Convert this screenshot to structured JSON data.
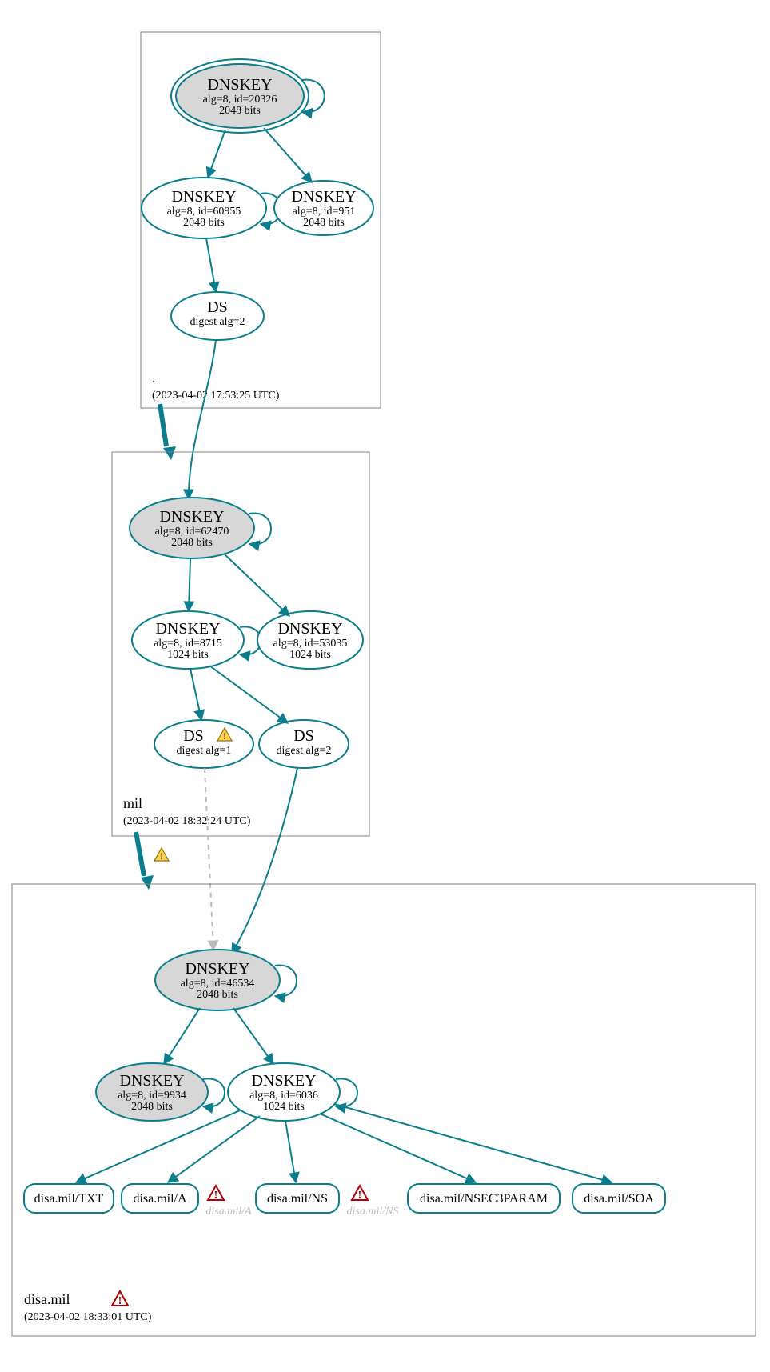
{
  "chart_data": {
    "type": "diagram",
    "title": "DNSSEC authentication graph",
    "zones": [
      {
        "name": ".",
        "timestamp": "(2023-04-02 17:53:25 UTC)",
        "nodes": [
          {
            "id": "root-ksk",
            "type": "DNSKEY",
            "alg": "alg=8, id=20326",
            "bits": "2048 bits",
            "shaded": true,
            "double": true,
            "selfloop": true
          },
          {
            "id": "root-zsk1",
            "type": "DNSKEY",
            "alg": "alg=8, id=60955",
            "bits": "2048 bits",
            "selfloop": true
          },
          {
            "id": "root-zsk2",
            "type": "DNSKEY",
            "alg": "alg=8, id=951",
            "bits": "2048 bits"
          },
          {
            "id": "root-ds",
            "type": "DS",
            "alg": "digest alg=2"
          }
        ],
        "edges": [
          [
            "root-ksk",
            "root-zsk1"
          ],
          [
            "root-ksk",
            "root-zsk2"
          ],
          [
            "root-zsk1",
            "root-ds"
          ]
        ]
      },
      {
        "name": "mil",
        "timestamp": "(2023-04-02 18:32:24 UTC)",
        "nodes": [
          {
            "id": "mil-ksk",
            "type": "DNSKEY",
            "alg": "alg=8, id=62470",
            "bits": "2048 bits",
            "shaded": true,
            "selfloop": true
          },
          {
            "id": "mil-zsk1",
            "type": "DNSKEY",
            "alg": "alg=8, id=8715",
            "bits": "1024 bits",
            "selfloop": true
          },
          {
            "id": "mil-zsk2",
            "type": "DNSKEY",
            "alg": "alg=8, id=53035",
            "bits": "1024 bits"
          },
          {
            "id": "mil-ds1",
            "type": "DS",
            "alg": "digest alg=1",
            "warning": true
          },
          {
            "id": "mil-ds2",
            "type": "DS",
            "alg": "digest alg=2"
          }
        ],
        "edges": [
          [
            "mil-ksk",
            "mil-zsk1"
          ],
          [
            "mil-ksk",
            "mil-zsk2"
          ],
          [
            "mil-zsk1",
            "mil-ds1"
          ],
          [
            "mil-zsk1",
            "mil-ds2"
          ]
        ]
      },
      {
        "name": "disa.mil",
        "timestamp": "(2023-04-02 18:33:01 UTC)",
        "warning_icon": "error",
        "nodes": [
          {
            "id": "disa-ksk",
            "type": "DNSKEY",
            "alg": "alg=8, id=46534",
            "bits": "2048 bits",
            "shaded": true,
            "selfloop": true
          },
          {
            "id": "disa-ksk2",
            "type": "DNSKEY",
            "alg": "alg=8, id=9934",
            "bits": "2048 bits",
            "shaded": true,
            "selfloop": true
          },
          {
            "id": "disa-zsk",
            "type": "DNSKEY",
            "alg": "alg=8, id=6036",
            "bits": "1024 bits",
            "selfloop": true
          },
          {
            "id": "rr-txt",
            "type": "RR",
            "label": "disa.mil/TXT"
          },
          {
            "id": "rr-a",
            "type": "RR",
            "label": "disa.mil/A"
          },
          {
            "id": "rr-a-missing",
            "type": "RR-missing",
            "label": "disa.mil/A",
            "error": true
          },
          {
            "id": "rr-ns",
            "type": "RR",
            "label": "disa.mil/NS"
          },
          {
            "id": "rr-ns-missing",
            "type": "RR-missing",
            "label": "disa.mil/NS",
            "error": true
          },
          {
            "id": "rr-nsec3",
            "type": "RR",
            "label": "disa.mil/NSEC3PARAM"
          },
          {
            "id": "rr-soa",
            "type": "RR",
            "label": "disa.mil/SOA"
          }
        ],
        "edges": [
          [
            "disa-ksk",
            "disa-ksk2"
          ],
          [
            "disa-ksk",
            "disa-zsk"
          ],
          [
            "disa-zsk",
            "rr-txt"
          ],
          [
            "disa-zsk",
            "rr-a"
          ],
          [
            "disa-zsk",
            "rr-ns"
          ],
          [
            "disa-zsk",
            "rr-nsec3"
          ],
          [
            "disa-zsk",
            "rr-soa"
          ]
        ]
      }
    ],
    "interzone_edges": [
      {
        "from": "root-ds",
        "to": "mil-ksk",
        "style": "solid",
        "delegation": true
      },
      {
        "from": "mil-ds1",
        "to": "disa-ksk",
        "style": "dashed",
        "delegation_warning": true
      },
      {
        "from": "mil-ds2",
        "to": "disa-ksk",
        "style": "solid"
      }
    ]
  },
  "labels": {
    "dnskey": "DNSKEY",
    "ds": "DS"
  },
  "node_text": {
    "root_ksk_alg": "alg=8, id=20326",
    "root_ksk_bits": "2048 bits",
    "root_zsk1_alg": "alg=8, id=60955",
    "root_zsk1_bits": "2048 bits",
    "root_zsk2_alg": "alg=8, id=951",
    "root_zsk2_bits": "2048 bits",
    "root_ds_alg": "digest alg=2",
    "mil_ksk_alg": "alg=8, id=62470",
    "mil_ksk_bits": "2048 bits",
    "mil_zsk1_alg": "alg=8, id=8715",
    "mil_zsk1_bits": "1024 bits",
    "mil_zsk2_alg": "alg=8, id=53035",
    "mil_zsk2_bits": "1024 bits",
    "mil_ds1_alg": "digest alg=1",
    "mil_ds2_alg": "digest alg=2",
    "disa_ksk_alg": "alg=8, id=46534",
    "disa_ksk_bits": "2048 bits",
    "disa_ksk2_alg": "alg=8, id=9934",
    "disa_ksk2_bits": "2048 bits",
    "disa_zsk_alg": "alg=8, id=6036",
    "disa_zsk_bits": "1024 bits",
    "rr_txt": "disa.mil/TXT",
    "rr_a": "disa.mil/A",
    "rr_a_missing": "disa.mil/A",
    "rr_ns": "disa.mil/NS",
    "rr_ns_missing": "disa.mil/NS",
    "rr_nsec3": "disa.mil/NSEC3PARAM",
    "rr_soa": "disa.mil/SOA"
  },
  "zone_labels": {
    "root_name": ".",
    "root_ts": "(2023-04-02 17:53:25 UTC)",
    "mil_name": "mil",
    "mil_ts": "(2023-04-02 18:32:24 UTC)",
    "disa_name": "disa.mil",
    "disa_ts": "(2023-04-02 18:33:01 UTC)"
  }
}
